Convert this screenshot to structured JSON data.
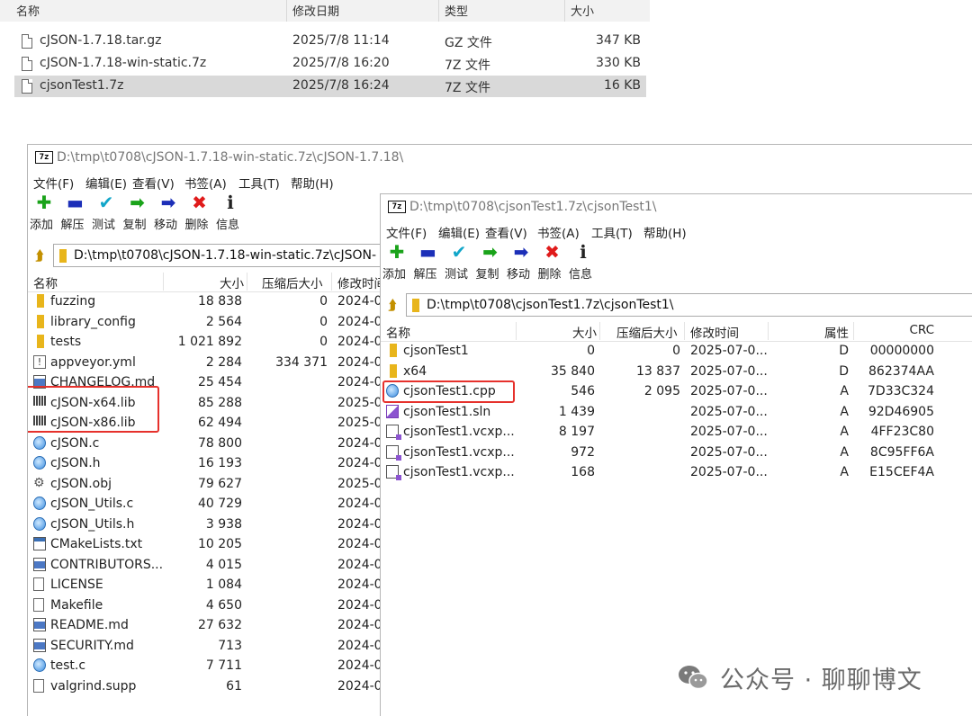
{
  "explorer": {
    "headers": {
      "name": "名称",
      "date": "修改日期",
      "type": "类型",
      "size": "大小"
    },
    "rows": [
      {
        "name": "cJSON-1.7.18.tar.gz",
        "date": "2025/7/8 11:14",
        "type": "GZ 文件",
        "size": "347 KB"
      },
      {
        "name": "cJSON-1.7.18-win-static.7z",
        "date": "2025/7/8 16:20",
        "type": "7Z 文件",
        "size": "330 KB"
      },
      {
        "name": "cjsonTest1.7z",
        "date": "2025/7/8 16:24",
        "type": "7Z 文件",
        "size": "16 KB",
        "selected": true
      }
    ]
  },
  "win1": {
    "logo": "7z",
    "title": "D:\\tmp\\t0708\\cJSON-1.7.18-win-static.7z\\cJSON-1.7.18\\",
    "menu": [
      "文件(F)",
      "编辑(E)",
      "查看(V)",
      "书签(A)",
      "工具(T)",
      "帮助(H)"
    ],
    "toolbar": [
      {
        "label": "添加",
        "icon": "plus-icon",
        "glyph": "✚",
        "color": "#1aa31a"
      },
      {
        "label": "解压",
        "icon": "minus-icon",
        "glyph": "▬",
        "color": "#1c2fb8"
      },
      {
        "label": "测试",
        "icon": "check-icon",
        "glyph": "✔",
        "color": "#12a6c9"
      },
      {
        "label": "复制",
        "icon": "copy-arrow-icon",
        "glyph": "➡",
        "color": "#1aa31a"
      },
      {
        "label": "移动",
        "icon": "move-arrow-icon",
        "glyph": "➡",
        "color": "#1c2fb8"
      },
      {
        "label": "删除",
        "icon": "delete-icon",
        "glyph": "✖",
        "color": "#e01b1b"
      },
      {
        "label": "信息",
        "icon": "info-icon",
        "glyph": "ℹ",
        "color": "#222222"
      }
    ],
    "path": "D:\\tmp\\t0708\\cJSON-1.7.18-win-static.7z\\cJSON-",
    "columns": {
      "name": "名称",
      "size": "大小",
      "packed": "压缩后大小",
      "modified": "修改时间"
    },
    "files": [
      {
        "name": "fuzzing",
        "size": "18 838",
        "packed": "0",
        "modified": "2024-0",
        "icon": "folder"
      },
      {
        "name": "library_config",
        "size": "2 564",
        "packed": "0",
        "modified": "2024-0",
        "icon": "folder"
      },
      {
        "name": "tests",
        "size": "1 021 892",
        "packed": "0",
        "modified": "2024-0",
        "icon": "folder"
      },
      {
        "name": "appveyor.yml",
        "size": "2 284",
        "packed": "334 371",
        "modified": "2024-0",
        "icon": "warn"
      },
      {
        "name": "CHANGELOG.md",
        "size": "25 454",
        "packed": "",
        "modified": "2024-0",
        "icon": "bluedoc"
      },
      {
        "name": "cJSON-x64.lib",
        "size": "85 288",
        "packed": "",
        "modified": "2025-0",
        "icon": "lib"
      },
      {
        "name": "cJSON-x86.lib",
        "size": "62 494",
        "packed": "",
        "modified": "2025-0",
        "icon": "lib"
      },
      {
        "name": "cJSON.c",
        "size": "78 800",
        "packed": "",
        "modified": "2024-0",
        "icon": "c"
      },
      {
        "name": "cJSON.h",
        "size": "16 193",
        "packed": "",
        "modified": "2024-0",
        "icon": "c"
      },
      {
        "name": "cJSON.obj",
        "size": "79 627",
        "packed": "",
        "modified": "2025-0",
        "icon": "obj"
      },
      {
        "name": "cJSON_Utils.c",
        "size": "40 729",
        "packed": "",
        "modified": "2024-0",
        "icon": "c"
      },
      {
        "name": "cJSON_Utils.h",
        "size": "3 938",
        "packed": "",
        "modified": "2024-0",
        "icon": "c"
      },
      {
        "name": "CMakeLists.txt",
        "size": "10 205",
        "packed": "",
        "modified": "2024-0",
        "icon": "txtico"
      },
      {
        "name": "CONTRIBUTORS...",
        "size": "4 015",
        "packed": "",
        "modified": "2024-0",
        "icon": "bluedoc"
      },
      {
        "name": "LICENSE",
        "size": "1 084",
        "packed": "",
        "modified": "2024-0",
        "icon": "doc"
      },
      {
        "name": "Makefile",
        "size": "4 650",
        "packed": "",
        "modified": "2024-0",
        "icon": "doc"
      },
      {
        "name": "README.md",
        "size": "27 632",
        "packed": "",
        "modified": "2024-0",
        "icon": "bluedoc"
      },
      {
        "name": "SECURITY.md",
        "size": "713",
        "packed": "",
        "modified": "2024-0",
        "icon": "bluedoc"
      },
      {
        "name": "test.c",
        "size": "7 711",
        "packed": "",
        "modified": "2024-0",
        "icon": "c"
      },
      {
        "name": "valgrind.supp",
        "size": "61",
        "packed": "",
        "modified": "2024-0",
        "icon": "doc"
      }
    ]
  },
  "win2": {
    "logo": "7z",
    "title": "D:\\tmp\\t0708\\cjsonTest1.7z\\cjsonTest1\\",
    "menu": [
      "文件(F)",
      "编辑(E)",
      "查看(V)",
      "书签(A)",
      "工具(T)",
      "帮助(H)"
    ],
    "path": "D:\\tmp\\t0708\\cjsonTest1.7z\\cjsonTest1\\",
    "columns": {
      "name": "名称",
      "size": "大小",
      "packed": "压缩后大小",
      "modified": "修改时间",
      "attr": "属性",
      "crc": "CRC"
    },
    "files": [
      {
        "name": "cjsonTest1",
        "size": "0",
        "packed": "0",
        "modified": "2025-07-0...",
        "attr": "D",
        "crc": "00000000",
        "icon": "folder"
      },
      {
        "name": "x64",
        "size": "35 840",
        "packed": "13 837",
        "modified": "2025-07-0...",
        "attr": "D",
        "crc": "862374AA",
        "icon": "folder"
      },
      {
        "name": "cjsonTest1.cpp",
        "size": "546",
        "packed": "2 095",
        "modified": "2025-07-0...",
        "attr": "A",
        "crc": "7D33C324",
        "icon": "c"
      },
      {
        "name": "cjsonTest1.sln",
        "size": "1 439",
        "packed": "",
        "modified": "2025-07-0...",
        "attr": "A",
        "crc": "92D46905",
        "icon": "sln"
      },
      {
        "name": "cjsonTest1.vcxp...",
        "size": "8 197",
        "packed": "",
        "modified": "2025-07-0...",
        "attr": "A",
        "crc": "4FF23C80",
        "icon": "vcx"
      },
      {
        "name": "cjsonTest1.vcxp...",
        "size": "972",
        "packed": "",
        "modified": "2025-07-0...",
        "attr": "A",
        "crc": "8C95FF6A",
        "icon": "vcx"
      },
      {
        "name": "cjsonTest1.vcxp...",
        "size": "168",
        "packed": "",
        "modified": "2025-07-0...",
        "attr": "A",
        "crc": "E15CEF4A",
        "icon": "vcx"
      }
    ]
  },
  "watermark": {
    "text": "公众号 · 聊聊博文",
    "icon": "wechat-icon"
  }
}
